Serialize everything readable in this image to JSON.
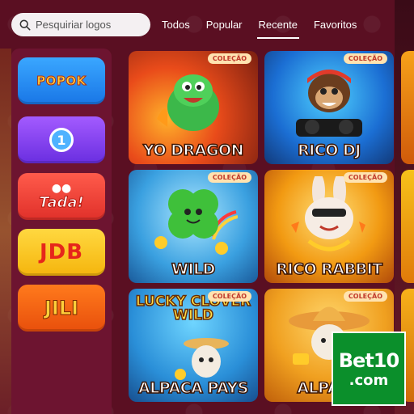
{
  "search": {
    "placeholder": "Pesquiriar logos"
  },
  "tabs": [
    {
      "label": "Todos"
    },
    {
      "label": "Popular"
    },
    {
      "label": "Recente",
      "active": true
    },
    {
      "label": "Favoritos"
    }
  ],
  "providers": [
    {
      "name": "POPOK"
    },
    {
      "name": "1"
    },
    {
      "name": "Tada!"
    },
    {
      "name": "JDB"
    },
    {
      "name": "JILI"
    }
  ],
  "games": [
    {
      "title": "YO DRAGON",
      "badge": "COLEÇÃO"
    },
    {
      "title": "RICO DJ",
      "badge": "COLEÇÃO"
    },
    {
      "title": "WILD",
      "badge": "COLEÇÃO"
    },
    {
      "title": "RICO RABBIT",
      "badge": "COLEÇÃO"
    },
    {
      "title": "ALPACA PAYS",
      "badge": "COLEÇÃO",
      "logo_text": "LUCKY CLOVER WILD"
    },
    {
      "title": "ALPACA",
      "badge": "COLEÇÃO"
    }
  ],
  "watermark": {
    "line1": "Bet10",
    "line2": ".com"
  },
  "colors": {
    "background": "#5a0f22",
    "panel": "#6d1430",
    "bet10_green": "#0b8f2b"
  }
}
